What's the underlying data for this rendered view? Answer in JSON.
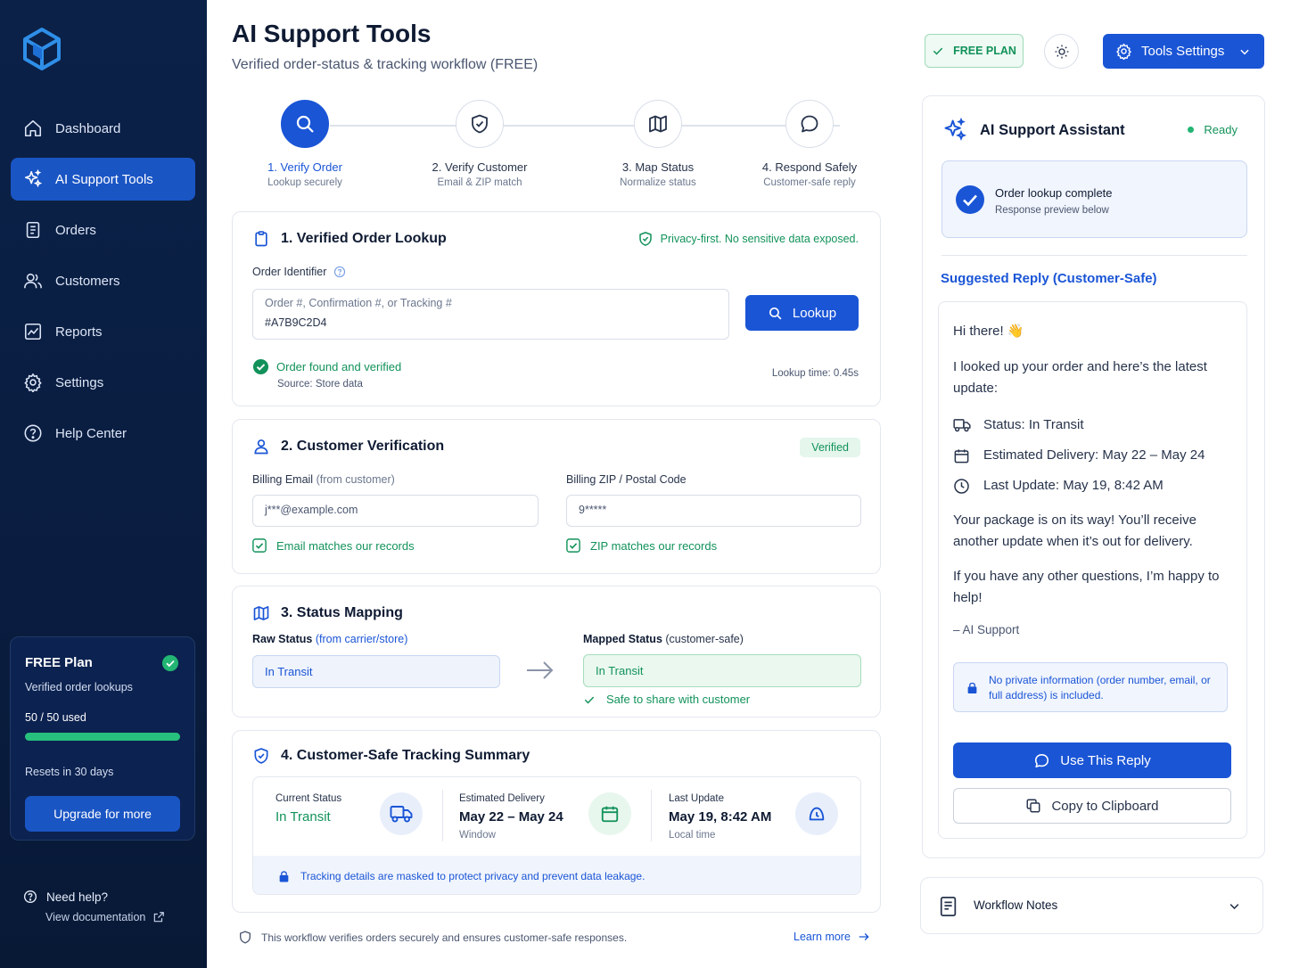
{
  "sidebar": {
    "items": [
      {
        "label": "Dashboard",
        "icon": "home-icon"
      },
      {
        "label": "AI Support Tools",
        "icon": "sparkles-icon"
      },
      {
        "label": "Orders",
        "icon": "clipboard-icon"
      },
      {
        "label": "Customers",
        "icon": "users-icon"
      },
      {
        "label": "Reports",
        "icon": "chart-icon"
      },
      {
        "label": "Settings",
        "icon": "gear-icon"
      },
      {
        "label": "Help Center",
        "icon": "help-icon"
      }
    ],
    "plan": {
      "title": "FREE Plan",
      "subtitle": "Verified order lookups",
      "used": "50 / 50 used",
      "used_fraction": 1.0,
      "reset": "Resets in 30 days",
      "upgrade": "Upgrade for more"
    },
    "help": {
      "title": "Need help?",
      "doc": "View documentation"
    }
  },
  "header": {
    "title": "AI Support Tools",
    "subtitle": "Verified order-status & tracking workflow (FREE)",
    "plan_badge": "FREE PLAN",
    "settings": "Tools Settings"
  },
  "steps": [
    {
      "label": "1. Verify Order",
      "sub": "Lookup securely"
    },
    {
      "label": "2. Verify Customer",
      "sub": "Email & ZIP match"
    },
    {
      "label": "3. Map Status",
      "sub": "Normalize status"
    },
    {
      "label": "4. Respond Safely",
      "sub": "Customer-safe reply"
    }
  ],
  "lookup": {
    "title": "1. Verified Order Lookup",
    "privacy": "Privacy-first. No sensitive data exposed.",
    "field_label": "Order Identifier",
    "placeholder": "Order #, Confirmation #, or Tracking #",
    "value": "#A7B9C2D4",
    "button": "Lookup",
    "status": "Order found and verified",
    "source": "Source: Store data",
    "time": "Lookup time: 0.45s"
  },
  "verification": {
    "title": "2. Customer Verification",
    "badge": "Verified",
    "email_label": "Billing Email",
    "email_label_note": "(from customer)",
    "email_value": "j***@example.com",
    "email_ok": "Email matches our records",
    "zip_label": "Billing ZIP / Postal Code",
    "zip_value": "9*****",
    "zip_ok": "ZIP matches our records"
  },
  "mapping": {
    "title": "3. Status Mapping",
    "raw_label": "Raw Status",
    "raw_note": "(from carrier/store)",
    "raw_value": "In Transit",
    "mapped_label": "Mapped Status",
    "mapped_note": "(customer-safe)",
    "mapped_value": "In Transit",
    "safe": "Safe to share with customer"
  },
  "summary": {
    "title": "4. Customer-Safe Tracking Summary",
    "current_label": "Current Status",
    "current_value": "In Transit",
    "delivery_label": "Estimated Delivery",
    "delivery_value": "May 22 – May 24",
    "delivery_note": "Window",
    "update_label": "Last Update",
    "update_value": "May 19, 8:42 AM",
    "update_note": "Local time",
    "mask_note": "Tracking details are masked to protect privacy and prevent data leakage."
  },
  "footer": {
    "text": "This workflow verifies orders securely and ensures customer-safe responses.",
    "link": "Learn more"
  },
  "assistant": {
    "title": "AI Support Assistant",
    "status": "Ready",
    "lookup_title": "Order lookup complete",
    "lookup_sub": "Response preview below",
    "suggested": "Suggested Reply (Customer-Safe)",
    "greeting": "Hi there! 👋",
    "intro": "I looked up your order and here’s the latest update:",
    "status_line": "Status: In Transit",
    "delivery_line": "Estimated Delivery: May 22 – May 24",
    "update_line": "Last Update: May 19, 8:42 AM",
    "body1": "Your package is on its way! You’ll receive another update when it’s out for delivery.",
    "body2": "If you have any other questions, I’m happy to help!",
    "signature": "– AI Support",
    "privacy": "No private information (order number, email, or full address) is included.",
    "use_reply": "Use This Reply",
    "copy": "Copy to Clipboard"
  },
  "notes": {
    "title": "Workflow Notes"
  },
  "colors": {
    "primary": "#1a55d6",
    "success": "#12925a",
    "sidebar": "#0b2148"
  }
}
